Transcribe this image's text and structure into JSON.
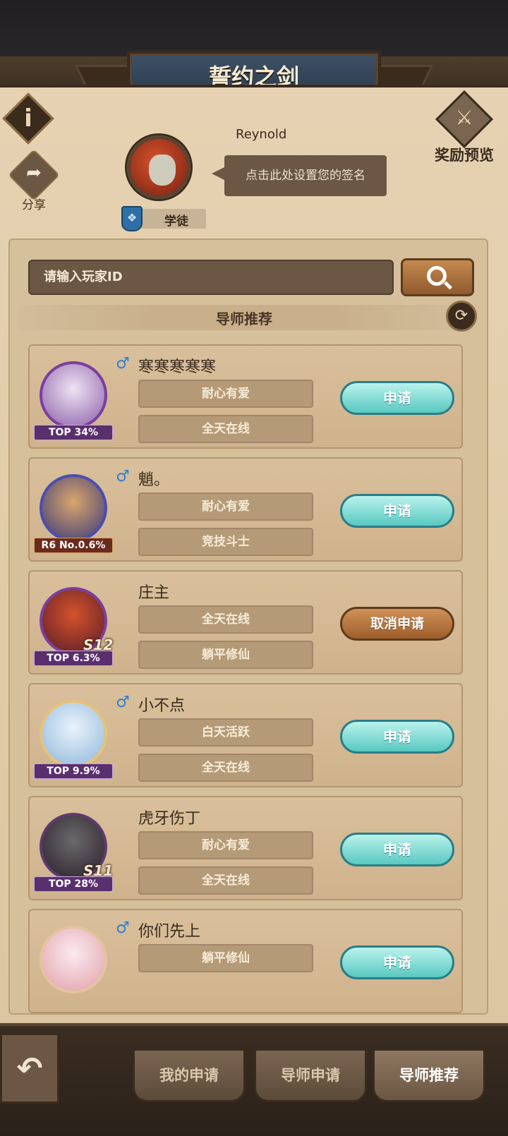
{
  "header": {
    "title": "誓约之剑"
  },
  "top_actions": {
    "info_glyph": "i",
    "share_label": "分享",
    "reward_label": "奖励预览"
  },
  "profile": {
    "name": "Reynold",
    "signature_placeholder": "点击此处设置您的签名",
    "rank_label": "学徒"
  },
  "search": {
    "placeholder": "请输入玩家ID"
  },
  "section": {
    "title": "导师推荐"
  },
  "mentors": [
    {
      "name": "寒寒寒寒寒",
      "gender": "♂",
      "rank": "TOP 34%",
      "season": "",
      "tags": [
        "耐心有爱",
        "全天在线"
      ],
      "action": "申请",
      "applied": false
    },
    {
      "name": "魈。",
      "gender": "♂",
      "rank": "R6 No.0.6%",
      "season": "",
      "tags": [
        "耐心有爱",
        "竞技斗士"
      ],
      "action": "申请",
      "applied": false
    },
    {
      "name": "庄主",
      "gender": "",
      "rank": "TOP 6.3%",
      "season": "S12",
      "tags": [
        "全天在线",
        "躺平修仙"
      ],
      "action": "取消申请",
      "applied": true
    },
    {
      "name": "小不点",
      "gender": "♂",
      "rank": "TOP 9.9%",
      "season": "",
      "tags": [
        "白天活跃",
        "全天在线"
      ],
      "action": "申请",
      "applied": false
    },
    {
      "name": "虎牙伤丁",
      "gender": "",
      "rank": "TOP 28%",
      "season": "S11",
      "tags": [
        "耐心有爱",
        "全天在线"
      ],
      "action": "申请",
      "applied": false
    },
    {
      "name": "你们先上",
      "gender": "♂",
      "rank": "",
      "season": "",
      "tags": [
        "躺平修仙",
        ""
      ],
      "action": "申请",
      "applied": false
    }
  ],
  "bottom_tabs": [
    {
      "label": "我的申请",
      "active": false
    },
    {
      "label": "导师申请",
      "active": false
    },
    {
      "label": "导师推荐",
      "active": true
    }
  ],
  "colors": {
    "panel": "#e6d2b2",
    "apply_button": "#59c9c1",
    "cancel_button": "#9d5e2b",
    "gender_male": "#2f7fd0"
  }
}
